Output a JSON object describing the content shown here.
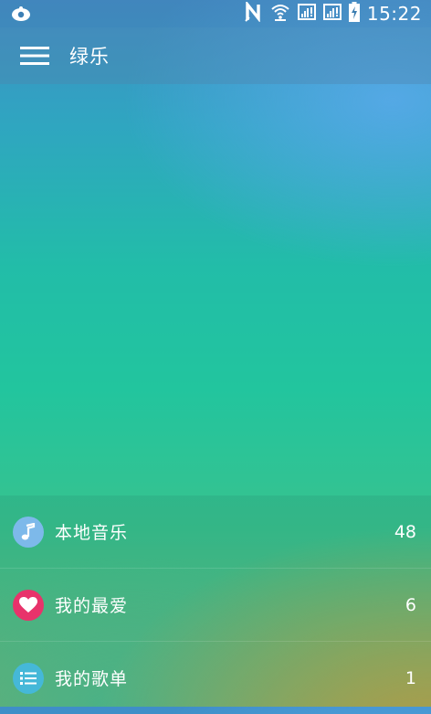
{
  "status_bar": {
    "time": "15:22",
    "icons": [
      "app-notification-icon",
      "nfc-icon",
      "wifi-icon",
      "sim1-signal-icon",
      "sim2-signal-icon",
      "battery-charging-icon"
    ]
  },
  "toolbar": {
    "title": "绿乐",
    "menu_icon": "hamburger-menu-icon"
  },
  "menu_items": [
    {
      "label": "本地音乐",
      "count": "48",
      "icon": "music-note-icon",
      "icon_color": "#7db9ea"
    },
    {
      "label": "我的最爱",
      "count": "6",
      "icon": "heart-icon",
      "icon_color": "#e8336b"
    },
    {
      "label": "我的歌单",
      "count": "1",
      "icon": "list-icon",
      "icon_color": "#45b8d8"
    }
  ]
}
